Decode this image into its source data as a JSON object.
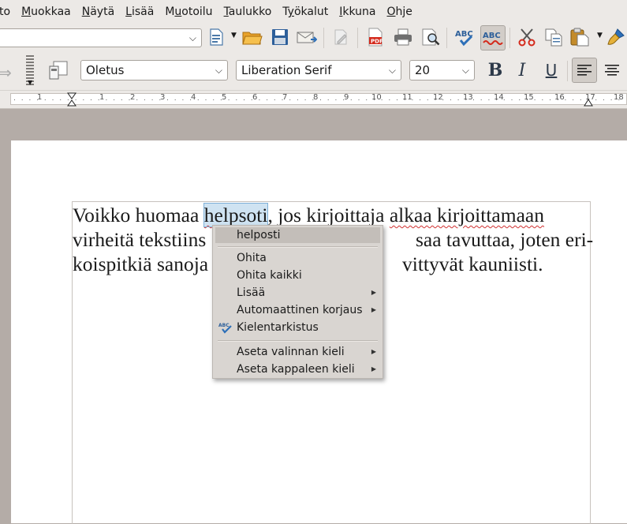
{
  "menubar": {
    "items": [
      "to",
      "Muokkaa",
      "Näytä",
      "Lisää",
      "Muotoilu",
      "Taulukko",
      "Työkalut",
      "Ikkuna",
      "Ohje"
    ]
  },
  "toolbar": {
    "paragraph_style": "Oletus",
    "font_name": "Liberation Serif",
    "font_size": "20"
  },
  "ruler": {
    "numbers": [
      "1",
      "1",
      "2",
      "3",
      "4",
      "5",
      "6",
      "7",
      "8",
      "9",
      "10",
      "11",
      "12",
      "13",
      "14",
      "15",
      "16",
      "17",
      "18"
    ]
  },
  "document": {
    "t1": "Voikko huomaa ",
    "t2": "helpsoti",
    "t3": ", jos kirjoittaja ",
    "t4": "alkaa kirjoittamaan",
    "line2a": "virheitä tekstiins",
    "line2b": "saa tavuttaa, joten eri-",
    "line3a": "koispitkiä sanoja",
    "line3b": "vittyvät kauniisti."
  },
  "context_menu": {
    "suggestion": "helposti",
    "ignore": "Ohita",
    "ignore_all": "Ohita kaikki",
    "add": "Lisää",
    "autocorrect": "Automaattinen korjaus",
    "spellcheck": "Kielentarkistus",
    "set_selection_language": "Aseta valinnan kieli",
    "set_paragraph_language": "Aseta kappaleen kieli"
  },
  "colors": {
    "background": "#b4aca7",
    "toolbar": "#ece9e6",
    "selection": "#cfe3f2",
    "spell_underline": "#d03030"
  }
}
